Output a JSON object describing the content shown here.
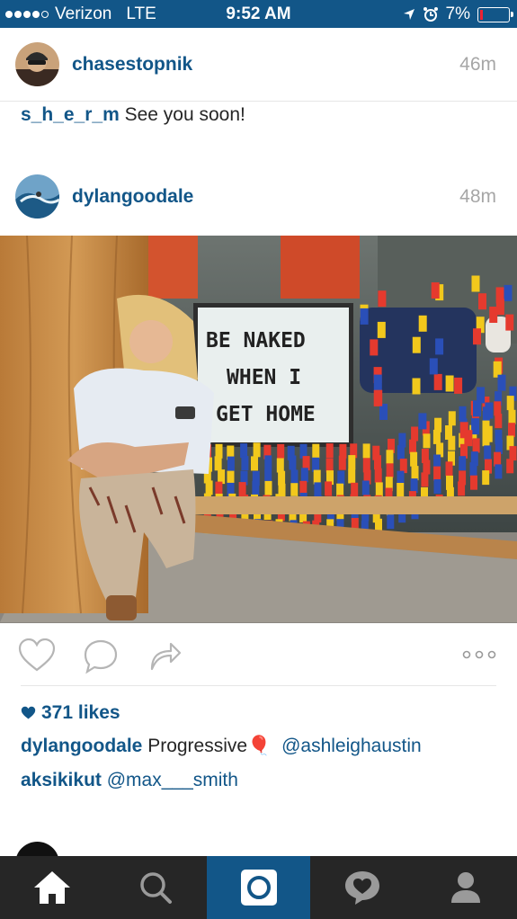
{
  "status_bar": {
    "carrier": "Verizon",
    "network": "LTE",
    "time": "9:52 AM",
    "battery_percent": "7%",
    "battery_level": 0.07,
    "signal_dots_filled": 4,
    "signal_dots_total": 5
  },
  "previous_post": {
    "username": "chasestopnik",
    "time_ago": "46m",
    "last_comment": {
      "user": "s_h_e_r_m",
      "text": "See you soon!"
    }
  },
  "post": {
    "username": "dylangoodale",
    "time_ago": "48m",
    "sign_lines": [
      "BE  NAKED",
      "WHEN  I",
      "GET HOME"
    ],
    "likes": "371 likes",
    "caption": {
      "user": "dylangoodale",
      "text": "Progressive",
      "emoji": "🎈",
      "mention": "@ashleighaustin"
    },
    "comment": {
      "user": "aksikikut",
      "mention": "@max___smith"
    }
  },
  "next_post": {
    "username": "",
    "time_ago": ""
  },
  "tabs": [
    {
      "name": "home",
      "active": false
    },
    {
      "name": "search",
      "active": false
    },
    {
      "name": "camera",
      "active": true
    },
    {
      "name": "activity",
      "active": false
    },
    {
      "name": "profile",
      "active": false
    }
  ],
  "colors": {
    "brand_blue": "#125688",
    "tabbar_dark": "#262626",
    "timestamp_gray": "#a6a6a6",
    "battery_low": "#ee2233"
  }
}
